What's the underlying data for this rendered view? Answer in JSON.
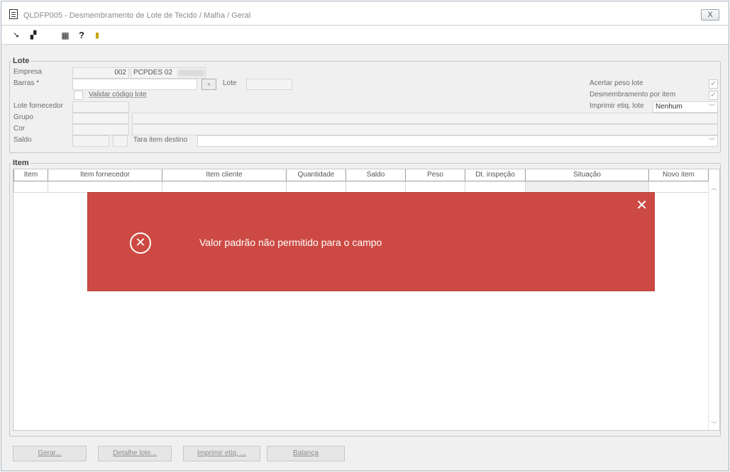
{
  "window": {
    "title": "QLDFP005 - Desmembramento de Lote de Tecido / Malha / Geral",
    "close_glyph": "X"
  },
  "toolbar": {
    "icons": [
      "arrow-in-icon",
      "copy-icon",
      "calendar-icon",
      "help-icon",
      "exit-icon"
    ]
  },
  "lote": {
    "legend": "Lote",
    "empresa_label": "Empresa",
    "empresa_code": "002",
    "empresa_name": "PCPDES 02",
    "barras_label": "Barras *",
    "barras_value": "",
    "lote_label": "Lote",
    "lote_value": "",
    "validar_label": "Validar código lote",
    "validar_checked": false,
    "lote_fornecedor_label": "Lote fornecedor",
    "grupo_label": "Grupo",
    "cor_label": "Cor",
    "saldo_label": "Saldo",
    "tara_label": "Tara item destino",
    "acertar_label": "Acertar peso lote",
    "acertar_checked": true,
    "desmembramento_label": "Desmembramento por item",
    "desmembramento_checked": true,
    "imprimir_label": "Imprimir etiq. lote",
    "imprimir_value": "Nenhum"
  },
  "item": {
    "legend": "Item",
    "columns": [
      "Item",
      "Item fornecedor",
      "Item cliente",
      "Quantidade",
      "Saldo",
      "Peso",
      "Dt. inspeção",
      "Situação",
      "Novo item"
    ]
  },
  "error": {
    "message": "Valor padrão não permitido para o campo",
    "icon": "error-circle-icon",
    "color": "#cc4a43"
  },
  "buttons": {
    "gerar": "Gerar...",
    "detalhe": "Detalhe lote...",
    "imprimir": "Imprimir etiq. ...",
    "balanca": "Balança"
  }
}
